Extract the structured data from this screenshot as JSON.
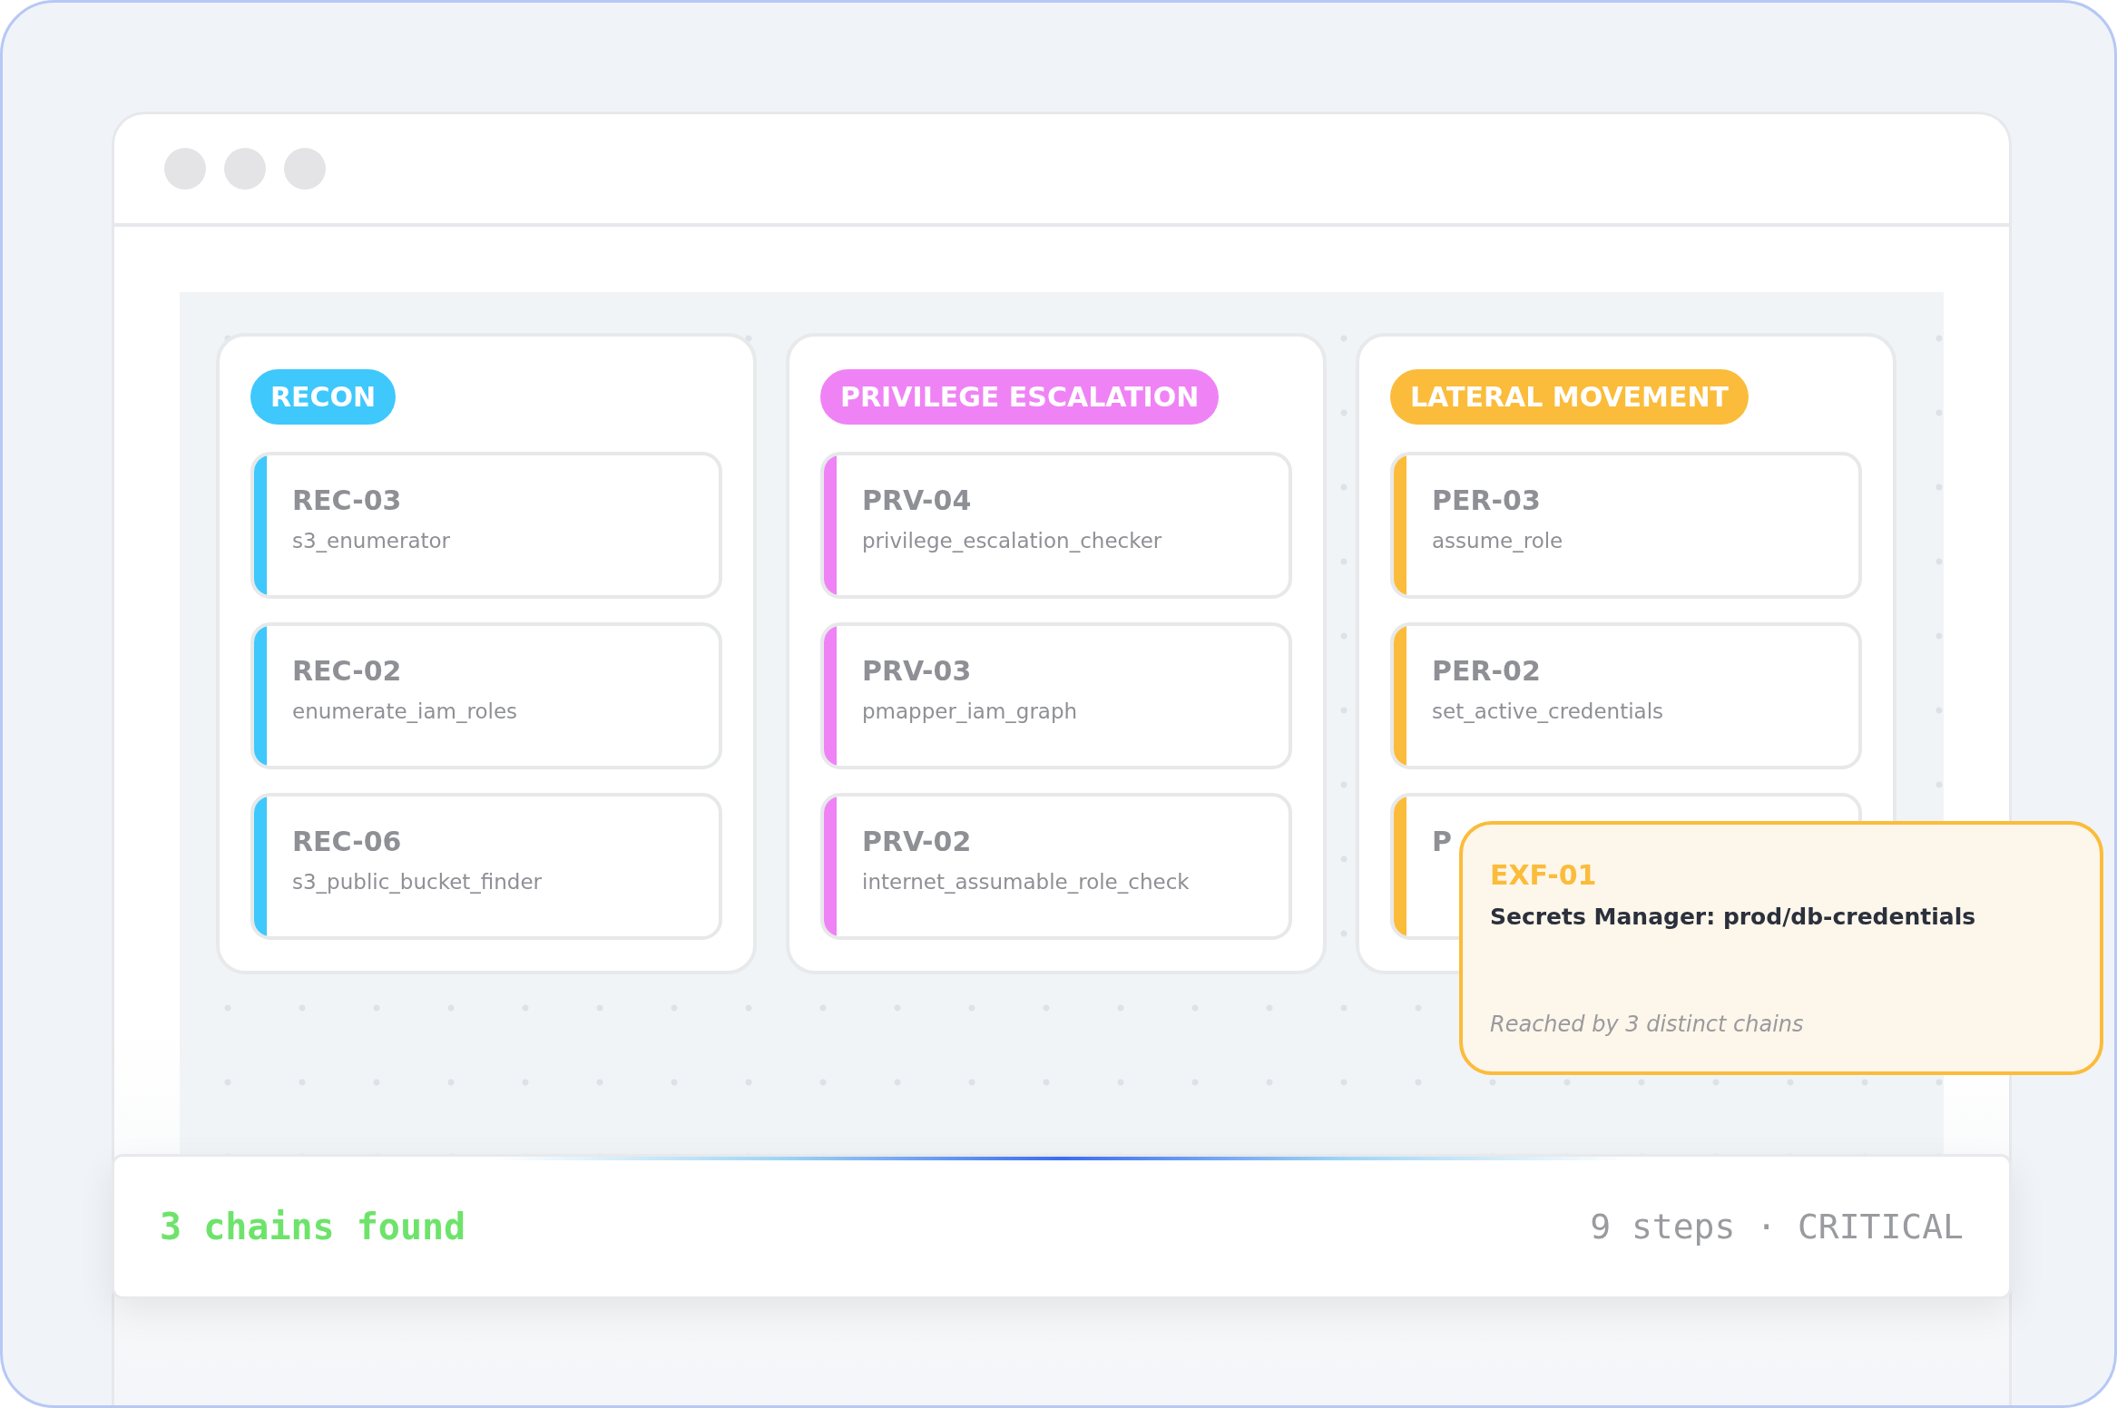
{
  "columns": [
    {
      "label": "RECON",
      "color": "#3ec8fc",
      "steps": [
        {
          "id": "REC-03",
          "name": "s3_enumerator"
        },
        {
          "id": "REC-02",
          "name": "enumerate_iam_roles"
        },
        {
          "id": "REC-06",
          "name": "s3_public_bucket_finder"
        }
      ]
    },
    {
      "label": "PRIVILEGE ESCALATION",
      "color": "#ef83f5",
      "steps": [
        {
          "id": "PRV-04",
          "name": "privilege_escalation_checker"
        },
        {
          "id": "PRV-03",
          "name": "pmapper_iam_graph"
        },
        {
          "id": "PRV-02",
          "name": "internet_assumable_role_check"
        }
      ]
    },
    {
      "label": "LATERAL MOVEMENT",
      "color": "#fbbc3b",
      "steps": [
        {
          "id": "PER-03",
          "name": "assume_role"
        },
        {
          "id": "PER-02",
          "name": "set_active_credentials"
        },
        {
          "id": "P"
        }
      ]
    }
  ],
  "tooltip": {
    "id": "EXF-01",
    "title": "Secrets Manager: prod/db-credentials",
    "note": "Reached by 3 distinct chains"
  },
  "status_bar": {
    "summary": "3 chains found",
    "detail": "9 steps · CRITICAL"
  }
}
